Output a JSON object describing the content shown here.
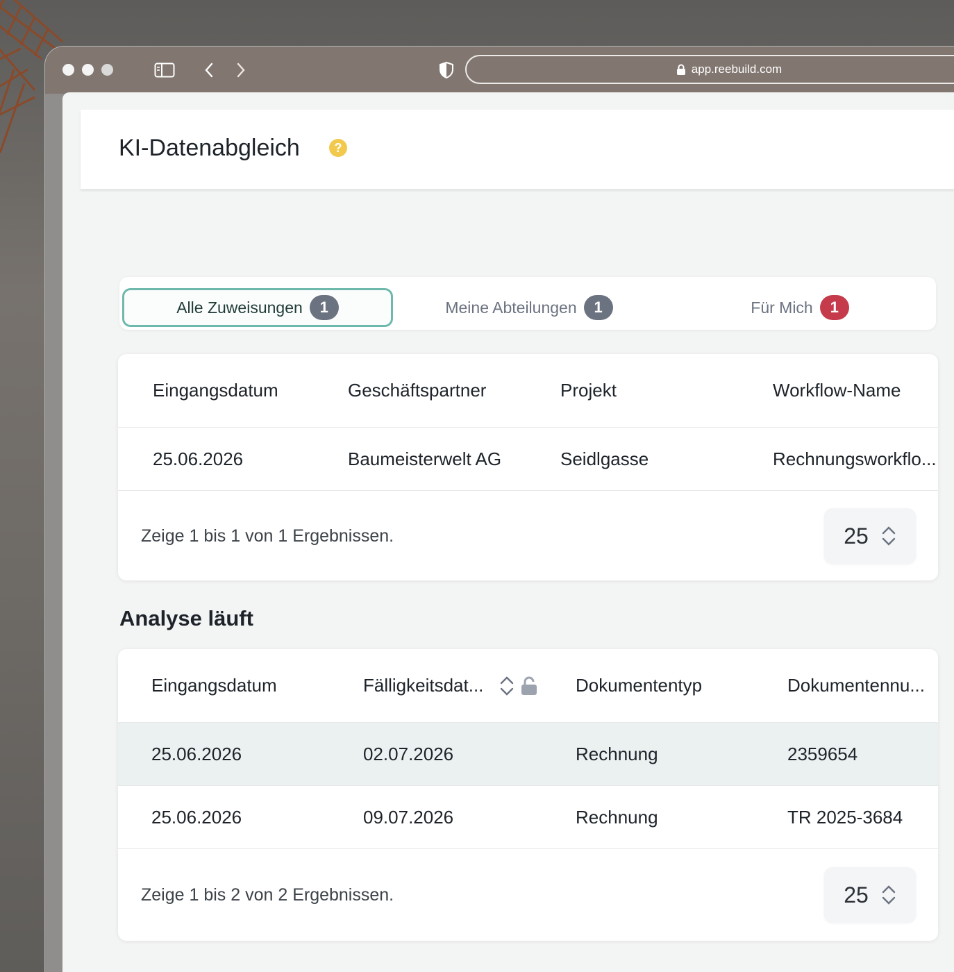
{
  "browser": {
    "url": "app.reebuild.com"
  },
  "page": {
    "title": "KI-Datenabgleich"
  },
  "tabs": [
    {
      "label": "Alle Zuweisungen",
      "count": "1",
      "active": true
    },
    {
      "label": "Meine Abteilungen",
      "count": "1",
      "active": false
    },
    {
      "label": "Für Mich",
      "count": "1",
      "active": false
    }
  ],
  "assignments_table": {
    "columns": [
      "Eingangsdatum",
      "Geschäftspartner",
      "Projekt",
      "Workflow-Name"
    ],
    "rows": [
      [
        "25.06.2026",
        "Baumeisterwelt AG",
        "Seidlgasse",
        "Rechnungsworkflo..."
      ]
    ],
    "footer": "Zeige 1 bis 1 von 1 Ergebnissen.",
    "page_size": "25"
  },
  "analysis": {
    "title": "Analyse läuft",
    "columns": [
      "Eingangsdatum",
      "Fälligkeitsdat...",
      "Dokumententyp",
      "Dokumentennu..."
    ],
    "rows": [
      [
        "25.06.2026",
        "02.07.2026",
        "Rechnung",
        "2359654"
      ],
      [
        "25.06.2026",
        "09.07.2026",
        "Rechnung",
        "TR 2025-3684"
      ]
    ],
    "footer": "Zeige 1 bis 2 von 2 Ergebnissen.",
    "page_size": "25"
  },
  "colors": {
    "accent_tab_border": "#6fb8ac",
    "badge_gray": "#6b7280",
    "badge_red": "#c53b4c",
    "help_yellow": "#f2c94c"
  }
}
